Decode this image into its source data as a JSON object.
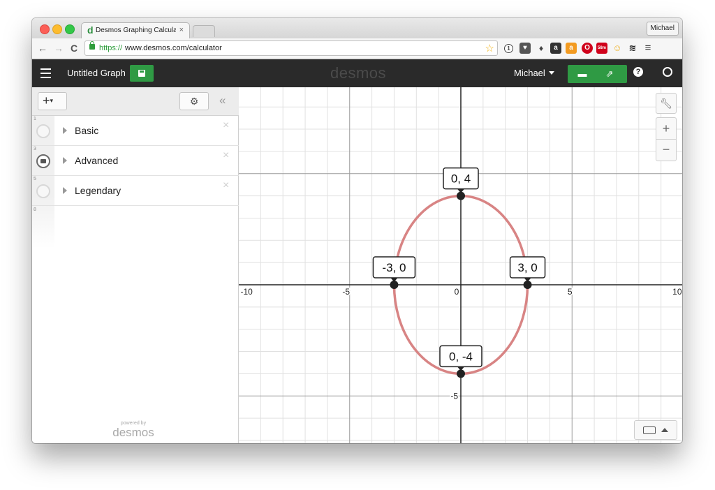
{
  "browser": {
    "tab_title": "Desmos Graphing Calculat",
    "tab_favicon": "d",
    "profile_name": "Michael",
    "url_scheme": "https://",
    "url_host": "www.desmos.com/calculator"
  },
  "header": {
    "graph_title": "Untitled Graph",
    "logo": "desmos",
    "user_name": "Michael"
  },
  "expressions": {
    "rows": [
      {
        "num": "1",
        "label": "Basic"
      },
      {
        "num": "3",
        "label": "Advanced"
      },
      {
        "num": "5",
        "label": "Legendary"
      }
    ],
    "empty_row_num": "8",
    "powered_small": "powered by",
    "powered_brand": "desmos"
  },
  "graph": {
    "xlim": [
      -10,
      10
    ],
    "ylim": [
      -7.8,
      8
    ],
    "x_tick_labels": [
      "-10",
      "-5",
      "0",
      "5",
      "10"
    ],
    "y_tick_labels": [
      "-5"
    ],
    "curve": {
      "type": "ellipse",
      "rx": 3,
      "ry": 4,
      "color": "#d67d7d"
    },
    "points": [
      {
        "x": 0,
        "y": 4,
        "label": "0, 4"
      },
      {
        "x": -3,
        "y": 0,
        "label": "-3, 0"
      },
      {
        "x": 3,
        "y": 0,
        "label": "3, 0"
      },
      {
        "x": 0,
        "y": -4,
        "label": "0, -4"
      }
    ]
  },
  "icons": {
    "wrench": "wrench-icon",
    "zoom_in": "+",
    "zoom_out": "−",
    "settings": "⚙",
    "collapse": "«",
    "add": "+",
    "close": "×"
  }
}
